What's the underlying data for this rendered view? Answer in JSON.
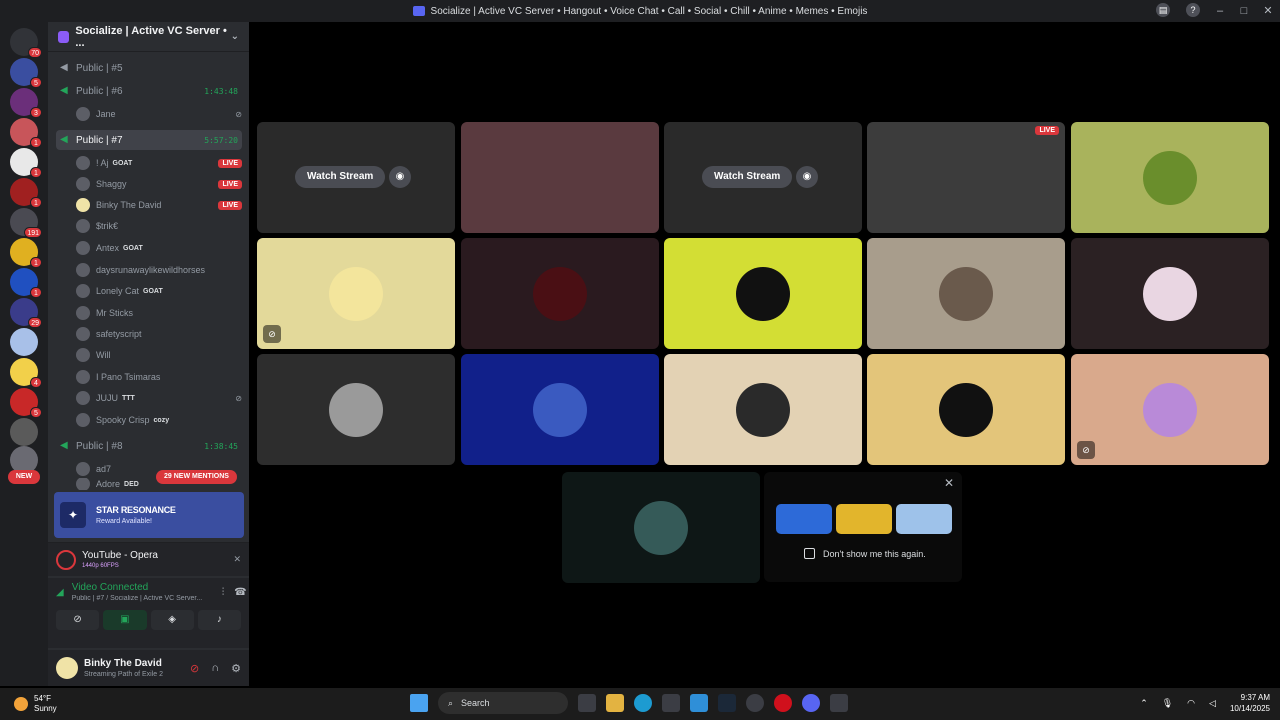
{
  "window": {
    "title": "Socialize | Active VC Server • Hangout • Voice Chat • Call • Social • Chill • Anime • Memes • Emojis"
  },
  "rail": {
    "badges": [
      "70",
      "5",
      "3",
      "1",
      "1",
      "1",
      "191",
      "1",
      "1",
      "29",
      "4",
      "5"
    ],
    "new_label": "NEW"
  },
  "server": {
    "name": "Socialize | Active VC Server • ..."
  },
  "channels": [
    {
      "name": "Public | #5",
      "time": ""
    },
    {
      "name": "Public | #6",
      "time": "1:43:48"
    },
    {
      "name": "Public | #7",
      "time": "5:57:20"
    },
    {
      "name": "Public | #8",
      "time": "1:38:45"
    }
  ],
  "users": [
    {
      "name": "Jane",
      "tag": "",
      "live": ""
    },
    {
      "name": "! Aj",
      "tag": "GOAT",
      "live": "LIVE"
    },
    {
      "name": "Shaggy",
      "tag": "",
      "live": "LIVE"
    },
    {
      "name": "Binky The David",
      "tag": "",
      "live": "LIVE"
    },
    {
      "name": "$trik€",
      "tag": "",
      "live": ""
    },
    {
      "name": "Antex",
      "tag": "GOAT",
      "live": ""
    },
    {
      "name": "daysrunawaylikewildhorses",
      "tag": "",
      "live": ""
    },
    {
      "name": "Lonely Cat",
      "tag": "GOAT",
      "live": ""
    },
    {
      "name": "Mr Sticks",
      "tag": "",
      "live": ""
    },
    {
      "name": "safetyscript",
      "tag": "",
      "live": ""
    },
    {
      "name": "Will",
      "tag": "",
      "live": ""
    },
    {
      "name": "I Pano Tsimaras",
      "tag": "",
      "live": ""
    },
    {
      "name": "JUJU",
      "tag": "TTT",
      "live": ""
    },
    {
      "name": "Spooky Crisp",
      "tag": "cozy",
      "live": ""
    },
    {
      "name": "ad7",
      "tag": "",
      "live": ""
    },
    {
      "name": "Adore",
      "tag": "DED",
      "live": ""
    }
  ],
  "mentions_pill": "29 NEW MENTIONS",
  "promo": {
    "title": "STAR RESONANCE",
    "subtitle": "Reward Available!"
  },
  "activity": {
    "title": "YouTube - Opera",
    "subtitle": "1440p 60FPS"
  },
  "voice": {
    "status": "Video Connected",
    "channel": "Public | #7 / Socialize | Active VC Server..."
  },
  "user": {
    "name": "Binky The David",
    "status": "Streaming Path of Exile 2"
  },
  "stage": {
    "watch_label": "Watch Stream",
    "live_label": "LIVE",
    "tiles": [
      {
        "bg": "#2a2a2a",
        "avatar": "",
        "watch": true,
        "live": false
      },
      {
        "bg": "#5a3a3f",
        "avatar": "",
        "watch": false,
        "live": false
      },
      {
        "bg": "#2a2a2a",
        "avatar": "",
        "watch": true,
        "live": false
      },
      {
        "bg": "#3c3c3c",
        "avatar": "",
        "watch": false,
        "live": true
      },
      {
        "bg": "#a9b35c",
        "avatar": "#6a8e2c",
        "watch": false,
        "live": false
      },
      {
        "bg": "#e3d99a",
        "avatar": "#f3e59c",
        "watch": false,
        "live": false
      },
      {
        "bg": "#2a1a1f",
        "avatar": "#4a0f14",
        "watch": false,
        "live": false
      },
      {
        "bg": "#d3de34",
        "avatar": "#111111",
        "watch": false,
        "live": false
      },
      {
        "bg": "#a89d8c",
        "avatar": "#6a5a4c",
        "watch": false,
        "live": false
      },
      {
        "bg": "#2b2123",
        "avatar": "#e9d6e2",
        "watch": false,
        "live": false
      },
      {
        "bg": "#2d2d2d",
        "avatar": "#9a9a9a",
        "watch": false,
        "live": false
      },
      {
        "bg": "#11208a",
        "avatar": "#3a5ac0",
        "watch": false,
        "live": false
      },
      {
        "bg": "#e3d2b4",
        "avatar": "#2a2a2a",
        "watch": false,
        "live": false
      },
      {
        "bg": "#e3c57a",
        "avatar": "#111111",
        "watch": false,
        "live": false
      },
      {
        "bg": "#d9a98c",
        "avatar": "#b98ad8",
        "watch": false,
        "live": false
      }
    ],
    "extra_tile": {
      "bg": "#0e1716",
      "avatar": "#355a58"
    }
  },
  "popup": {
    "checkbox_label": "Don't show me this again.",
    "game_colors": [
      "#2d6ad8",
      "#e2b52c",
      "#9ec2ea"
    ]
  },
  "taskbar": {
    "temp": "54°F",
    "weather": "Sunny",
    "search": "Search",
    "time": "9:37 AM",
    "date": "10/14/2025"
  }
}
